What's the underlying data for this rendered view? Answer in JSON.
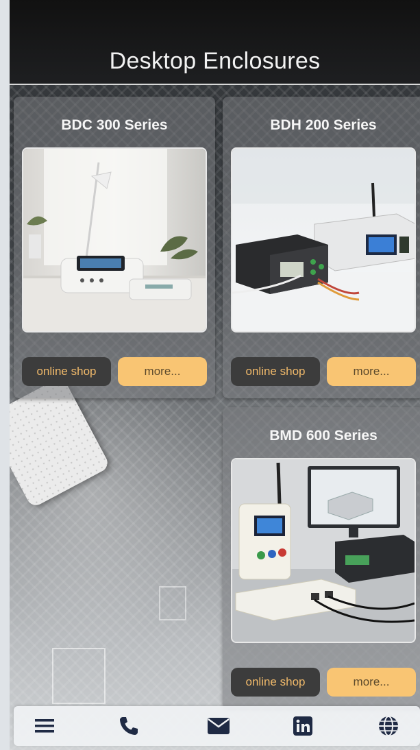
{
  "header": {
    "title": "Desktop Enclosures"
  },
  "products": [
    {
      "title": "BDC 300 Series",
      "shop_label": "online shop",
      "more_label": "more..."
    },
    {
      "title": "BDH 200 Series",
      "shop_label": "online shop",
      "more_label": "more..."
    },
    {
      "title": "BMD 600 Series",
      "shop_label": "online shop",
      "more_label": "more..."
    }
  ],
  "bottom_nav": {
    "icons": [
      "menu-icon",
      "phone-icon",
      "mail-icon",
      "linkedin-icon",
      "globe-icon"
    ]
  },
  "colors": {
    "header_bg": "#111111",
    "shop_button_bg": "#3c3c3c",
    "shop_button_text": "#f0b96a",
    "more_button_bg": "#f9c573",
    "nav_icon": "#1f2a44"
  }
}
